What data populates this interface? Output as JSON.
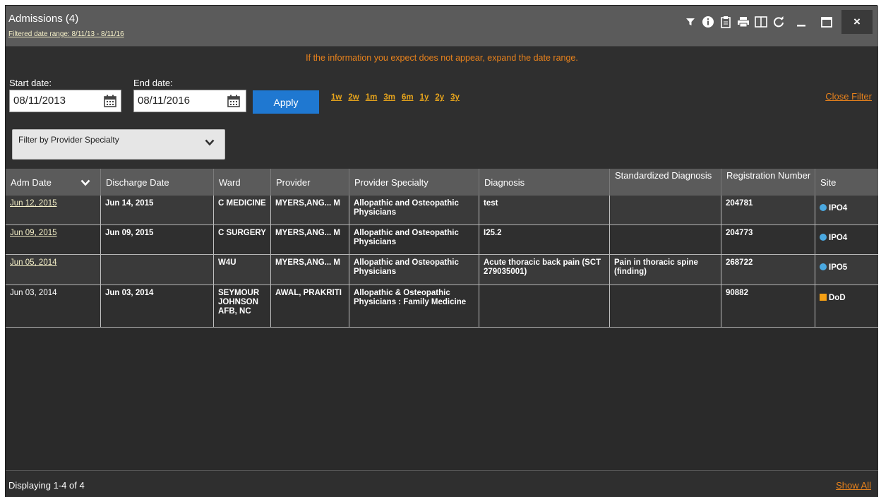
{
  "header": {
    "title": "Admissions (4)",
    "subtitle": "Filtered date range: 8/11/13 - 8/11/16",
    "close_label": "×"
  },
  "filter": {
    "notice": "If the information you expect does not appear, expand the date range.",
    "start_label": "Start date:",
    "start_value": "08/11/2013",
    "end_label": "End date:",
    "end_value": "08/11/2016",
    "apply_label": "Apply",
    "quick_ranges": [
      "1w",
      "2w",
      "1m",
      "3m",
      "6m",
      "1y",
      "2y",
      "3y"
    ],
    "close_filter_label": "Close Filter",
    "specialty_placeholder": "Filter by Provider Specialty"
  },
  "table": {
    "columns": [
      "Adm Date",
      "Discharge Date",
      "Ward",
      "Provider",
      "Provider Specialty",
      "Diagnosis",
      "Standardized Diagnosis",
      "Registration Number",
      "Site"
    ],
    "rows": [
      {
        "adm_date": "Jun 12, 2015",
        "discharge_date": "Jun 14, 2015",
        "ward": "C MEDICINE",
        "provider": "MYERS,ANG... M",
        "specialty": "Allopathic and Osteopathic Physicians",
        "diagnosis": "test",
        "std_diagnosis": "",
        "registration": "204781",
        "site": "IPO4"
      },
      {
        "adm_date": "Jun 09, 2015",
        "discharge_date": "Jun 09, 2015",
        "ward": "C SURGERY",
        "provider": "MYERS,ANG... M",
        "specialty": "Allopathic and Osteopathic Physicians",
        "diagnosis": "I25.2",
        "std_diagnosis": "",
        "registration": "204773",
        "site": "IPO4"
      },
      {
        "adm_date": "Jun 05, 2014",
        "discharge_date": "",
        "ward": "W4U",
        "provider": "MYERS,ANG... M",
        "specialty": "Allopathic and Osteopathic Physicians",
        "diagnosis": "Acute thoracic back pain (SCT 279035001)",
        "std_diagnosis": "Pain in thoracic spine (finding)",
        "registration": "268722",
        "site": "IPO5"
      },
      {
        "adm_date": "Jun 03, 2014",
        "discharge_date": "Jun 03, 2014",
        "ward": "SEYMOUR JOHNSON AFB, NC",
        "provider": "AWAL, PRAKRITI",
        "specialty": "Allopathic & Osteopathic Physicians : Family Medicine",
        "diagnosis": "",
        "std_diagnosis": "",
        "registration": "90882",
        "site": "DoD"
      }
    ]
  },
  "footer": {
    "displaying": "Displaying 1-4 of 4",
    "show_all": "Show All"
  },
  "colors": {
    "accent_orange": "#e8821c",
    "apply_blue": "#1f78d1",
    "site_ipo": "#4aa8e0",
    "site_dod": "#f5a014"
  },
  "icons": [
    "filter-icon",
    "info-icon",
    "clipboard-icon",
    "print-icon",
    "columns-icon",
    "refresh-icon",
    "minimize-icon",
    "maximize-icon",
    "close-icon",
    "calendar-icon",
    "chevron-down-icon"
  ]
}
